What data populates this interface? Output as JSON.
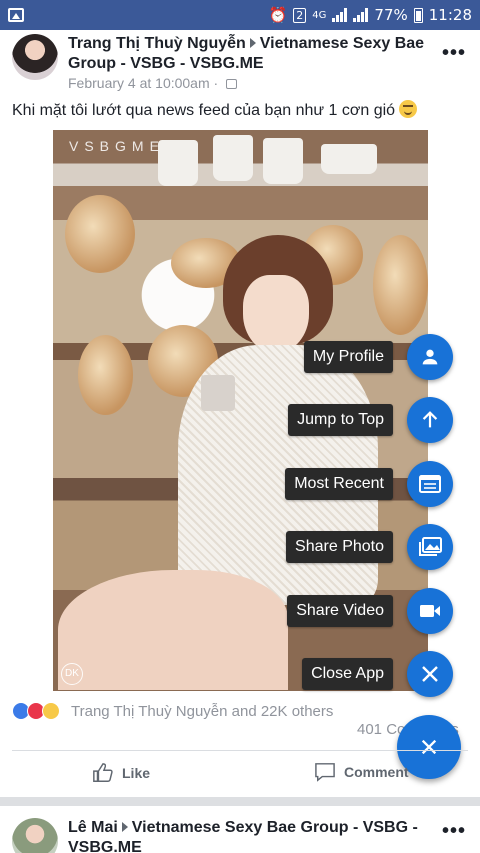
{
  "status_bar": {
    "time": "11:28",
    "battery": "77%",
    "network": "4G",
    "sim_slot": "2"
  },
  "post": {
    "author": "Trang Thị Thuỳ Nguyễn",
    "group": "Vietnamese Sexy Bae Group - VSBG - VSBG.ME",
    "timestamp": "February 4 at 10:00am",
    "text": "Khi mặt tôi lướt qua news feed của bạn như 1 cơn gió",
    "watermark": "VSBGME",
    "reactions_summary": "Trang Thị Thuỳ Nguyễn and 22K others",
    "comments_count": "401 Comments",
    "actions": {
      "like": "Like",
      "comment": "Comment"
    }
  },
  "fab_menu": {
    "items": [
      {
        "label": "My Profile",
        "icon": "person-icon"
      },
      {
        "label": "Jump to Top",
        "icon": "arrow-up-icon"
      },
      {
        "label": "Most Recent",
        "icon": "feed-icon"
      },
      {
        "label": "Share Photo",
        "icon": "photos-icon"
      },
      {
        "label": "Share Video",
        "icon": "video-camera-icon"
      },
      {
        "label": "Close App",
        "icon": "close-icon"
      }
    ],
    "toggle_icon": "close-icon"
  },
  "next_post": {
    "author": "Lê Mai",
    "group": "Vietnamese Sexy Bae Group - VSBG - VSBG.ME"
  },
  "colors": {
    "status_bar": "#3b5998",
    "fab": "#1872d7",
    "label_bg": "#2a2a2a"
  }
}
